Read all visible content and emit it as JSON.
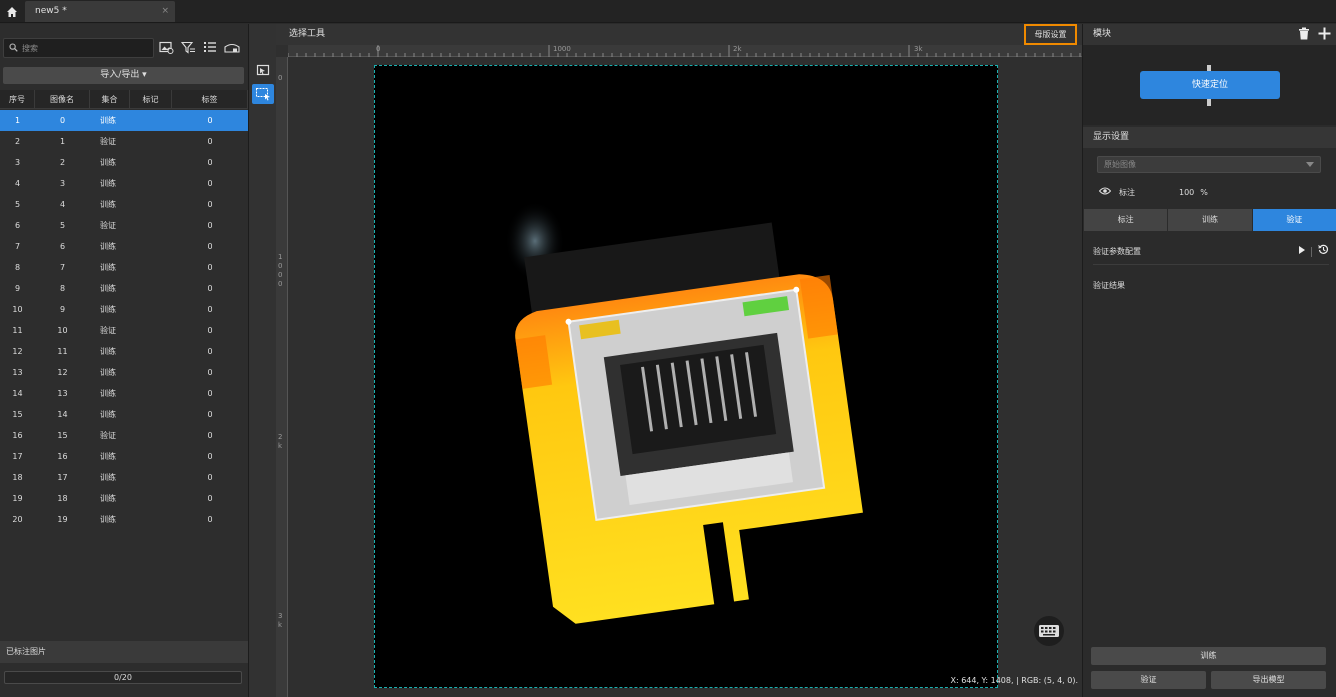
{
  "tabbar": {
    "tab_title": "new5 *",
    "close": "×"
  },
  "left": {
    "search_placeholder": "搜索",
    "import_export": "导入/导出 ▾",
    "columns": [
      "序号",
      "图像名",
      "集合",
      "标记",
      "标签"
    ],
    "rows": [
      [
        "1",
        "0",
        "训练",
        "",
        "0"
      ],
      [
        "2",
        "1",
        "验证",
        "",
        "0"
      ],
      [
        "3",
        "2",
        "训练",
        "",
        "0"
      ],
      [
        "4",
        "3",
        "训练",
        "",
        "0"
      ],
      [
        "5",
        "4",
        "训练",
        "",
        "0"
      ],
      [
        "6",
        "5",
        "验证",
        "",
        "0"
      ],
      [
        "7",
        "6",
        "训练",
        "",
        "0"
      ],
      [
        "8",
        "7",
        "训练",
        "",
        "0"
      ],
      [
        "9",
        "8",
        "训练",
        "",
        "0"
      ],
      [
        "10",
        "9",
        "训练",
        "",
        "0"
      ],
      [
        "11",
        "10",
        "验证",
        "",
        "0"
      ],
      [
        "12",
        "11",
        "训练",
        "",
        "0"
      ],
      [
        "13",
        "12",
        "训练",
        "",
        "0"
      ],
      [
        "14",
        "13",
        "训练",
        "",
        "0"
      ],
      [
        "15",
        "14",
        "训练",
        "",
        "0"
      ],
      [
        "16",
        "15",
        "验证",
        "",
        "0"
      ],
      [
        "17",
        "16",
        "训练",
        "",
        "0"
      ],
      [
        "18",
        "17",
        "训练",
        "",
        "0"
      ],
      [
        "19",
        "18",
        "训练",
        "",
        "0"
      ],
      [
        "20",
        "19",
        "训练",
        "",
        "0"
      ]
    ],
    "selected_row": 0,
    "labeled_images": "已标注图片",
    "progress_text": "0/20",
    "progress_fraction": 0
  },
  "center": {
    "title": "选择工具",
    "template_btn": "母版设置",
    "ruler_top": [
      "0",
      "1000",
      "2k",
      "3k"
    ],
    "ruler_left": [
      "0",
      "1",
      "0",
      "0",
      "0",
      "2",
      "k",
      "3",
      "k"
    ],
    "coords": "X: 644, Y: 1408, | RGB: (5, 4, 0)."
  },
  "right": {
    "header": "模块",
    "quick_locate": "快速定位",
    "display_settings": "显示设置",
    "dropdown_value": "原始图像",
    "label_text": "标注",
    "opacity": "100",
    "opacity_unit": "%",
    "tabs": [
      "标注",
      "训练",
      "验证"
    ],
    "active_tab": 2,
    "param_config": "验证参数配置",
    "result": "验证结果",
    "train_btn": "训练",
    "verify_btn": "验证",
    "export_btn": "导出模型"
  },
  "colors": {
    "accent": "#2e86de",
    "highlight": "#f08a00"
  }
}
